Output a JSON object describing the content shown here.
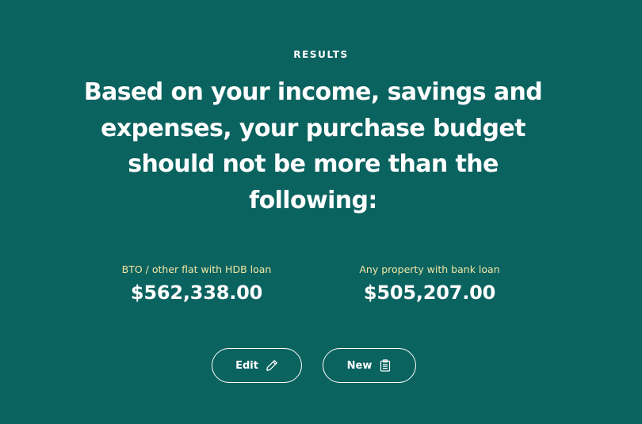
{
  "results": {
    "eyebrow": "RESULTS",
    "headline": "Based on your income, savings and expenses, your purchase budget should not be more than the following:"
  },
  "budgets": [
    {
      "label": "BTO / other flat with HDB loan",
      "value": "$562,338.00"
    },
    {
      "label": "Any property with bank loan",
      "value": "$505,207.00"
    }
  ],
  "actions": {
    "edit_label": "Edit",
    "edit_icon": "pencil-icon",
    "new_label": "New",
    "new_icon": "clipboard-icon"
  },
  "colors": {
    "background": "#0b6360",
    "label_accent": "#f2e6a3",
    "text": "#ffffff"
  }
}
